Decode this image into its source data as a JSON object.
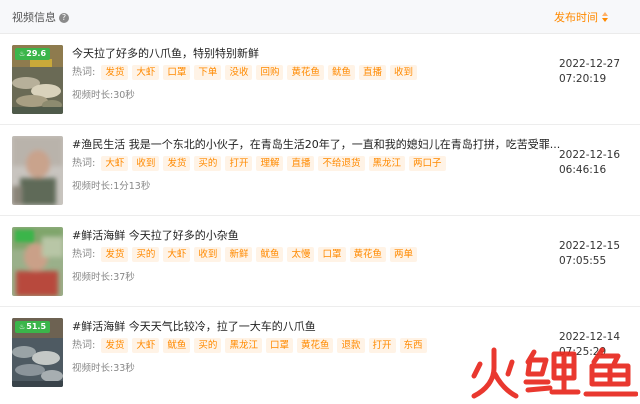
{
  "header": {
    "title": "视频信息",
    "help_glyph": "?",
    "sort_label": "发布时间"
  },
  "hot_label": "热词:",
  "duration_label": "视频时长:",
  "accent": "#ff8a00",
  "tag_bg": "#fff3e6",
  "score_bg": "#3bb54a",
  "videos": [
    {
      "score": "29.6",
      "title": "今天拉了好多的八爪鱼，特别特别新鲜",
      "tags": [
        "发货",
        "大虾",
        "口罩",
        "下单",
        "没收",
        "回购",
        "黄花鱼",
        "鱿鱼",
        "直播",
        "收到"
      ],
      "duration": "30秒",
      "date": "2022-12-27",
      "time": "07:20:19"
    },
    {
      "score": "",
      "title": "#渔民生活 我是一个东北的小伙子，在青岛生活20年了，一直和我的媳妇儿在青岛打拼，吃苦受罪...",
      "tags": [
        "大虾",
        "收到",
        "发货",
        "买的",
        "打开",
        "理解",
        "直播",
        "不给退货",
        "黑龙江",
        "两口子"
      ],
      "duration": "1分13秒",
      "date": "2022-12-16",
      "time": "06:46:16"
    },
    {
      "score": "",
      "title": "#鲜活海鲜 今天拉了好多的小杂鱼",
      "tags": [
        "发货",
        "买的",
        "大虾",
        "收到",
        "新鲜",
        "鱿鱼",
        "太慢",
        "口罩",
        "黄花鱼",
        "两单"
      ],
      "duration": "37秒",
      "date": "2022-12-15",
      "time": "07:05:55"
    },
    {
      "score": "51.5",
      "title": "#鲜活海鲜 今天天气比较冷，拉了一大车的八爪鱼",
      "tags": [
        "发货",
        "大虾",
        "鱿鱼",
        "买的",
        "黑龙江",
        "口罩",
        "黄花鱼",
        "退款",
        "打开",
        "东西"
      ],
      "duration": "33秒",
      "date": "2022-12-14",
      "time": "07:25:29"
    }
  ],
  "watermark": "火鲤鱼"
}
